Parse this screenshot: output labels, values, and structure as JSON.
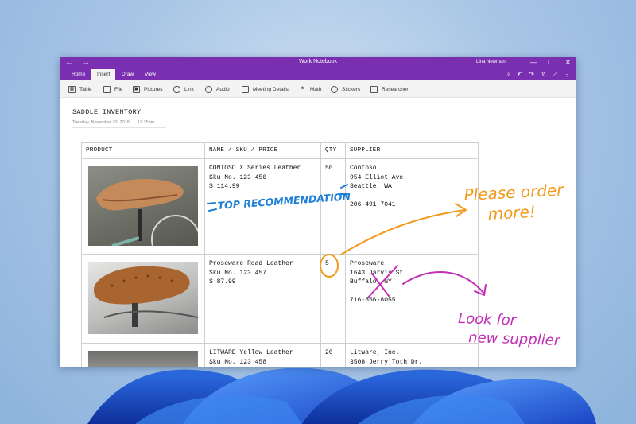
{
  "window": {
    "title": "Work Notebook",
    "user": "Lina Newman",
    "nav_back": "←",
    "nav_forward": "→",
    "controls": {
      "minimize": "—",
      "maximize": "☐",
      "close": "✕"
    }
  },
  "ribbon": {
    "tabs": [
      {
        "label": "Home",
        "active": false
      },
      {
        "label": "Insert",
        "active": true
      },
      {
        "label": "Draw",
        "active": false
      },
      {
        "label": "View",
        "active": false
      }
    ],
    "right_icons": [
      "lightbulb-icon",
      "undo-icon",
      "redo-icon",
      "share-icon",
      "fullscreen-icon",
      "more-icon"
    ]
  },
  "toolbar": {
    "items": [
      {
        "label": "Table",
        "icon": "table-icon"
      },
      {
        "label": "File",
        "icon": "file-icon"
      },
      {
        "label": "Pictures",
        "icon": "pictures-icon"
      },
      {
        "label": "Link",
        "icon": "link-icon"
      },
      {
        "label": "Audio",
        "icon": "audio-icon"
      },
      {
        "label": "Meeting Details",
        "icon": "meeting-details-icon"
      },
      {
        "label": "Math",
        "icon": "math-icon"
      },
      {
        "label": "Stickers",
        "icon": "stickers-icon"
      },
      {
        "label": "Researcher",
        "icon": "researcher-icon"
      }
    ]
  },
  "page": {
    "title": "SADDLE INVENTORY",
    "date": "Tuesday, November 20, 2018",
    "time": "12:35pm"
  },
  "table": {
    "headers": [
      "PRODUCT",
      "NAME / SKU / PRICE",
      "QTY",
      "SUPPLIER"
    ],
    "rows": [
      {
        "name": "CONTOSO X Series Leather",
        "sku": "Sku No. 123 456",
        "price": "$ 114.99",
        "qty": "50",
        "supplier": "Contoso",
        "address": "954 Elliot Ave.",
        "city": "Seattle, WA",
        "phone": "206-491-7041"
      },
      {
        "name": "Proseware Road Leather",
        "sku": "Sku No. 123 457",
        "price": "$ 87.99",
        "qty": "5",
        "supplier": "Proseware",
        "address": "1643 Jarvis St.",
        "city": "Buffalo, NY",
        "phone": "716-856-8055"
      },
      {
        "name": "LITWARE Yellow Leather",
        "sku": "Sku No. 123 458",
        "price": "",
        "qty": "20",
        "supplier": "Litware, Inc.",
        "address": "3508 Jerry Toth Dr.",
        "city": "",
        "phone": ""
      }
    ]
  },
  "ink": {
    "top_recommendation": "TOP RECOMMENDATION",
    "please_order_line1": "Please order",
    "please_order_line2": "more!",
    "look_for_line1": "Look for",
    "look_for_line2": "new supplier",
    "colors": {
      "blue": "#1e7fd8",
      "orange": "#f29a1d",
      "magenta": "#c22fb4"
    }
  },
  "colors": {
    "accent": "#7a2fb0",
    "toolbar_bg": "#f3f3f3",
    "grid": "#cfcfcf"
  }
}
